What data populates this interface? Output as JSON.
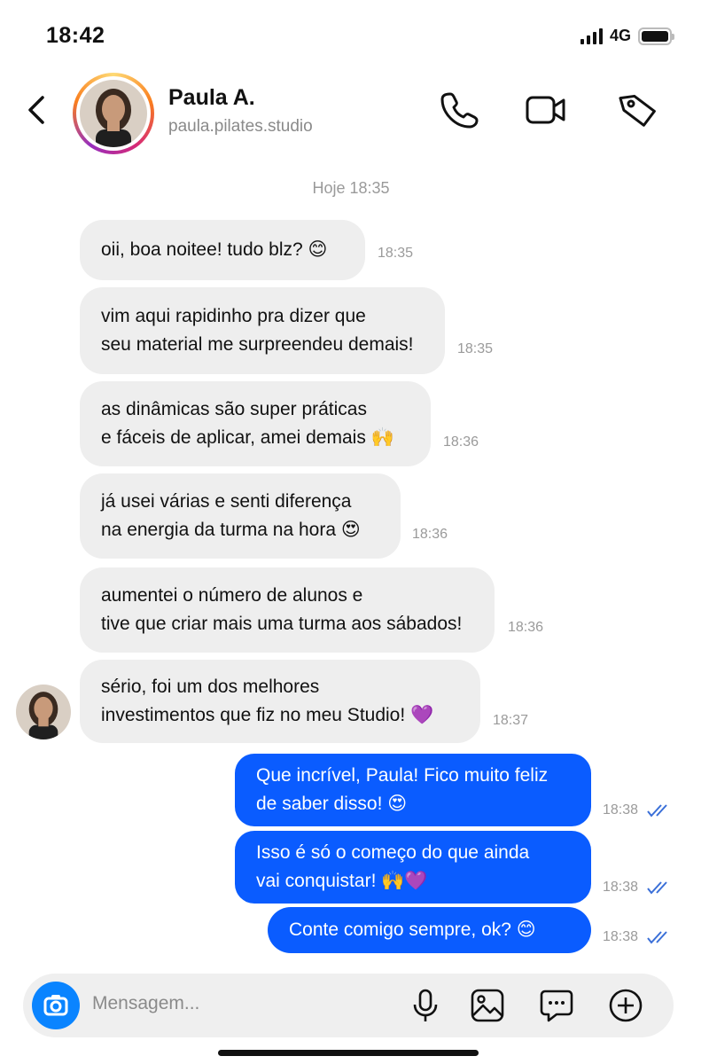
{
  "status_bar": {
    "time": "18:42",
    "network": "4G"
  },
  "header": {
    "contact_name": "Paula A.",
    "contact_handle": "paula.pilates.studio",
    "icons": [
      "back-icon",
      "phone-icon",
      "video-camera-icon",
      "tag-icon"
    ]
  },
  "chat": {
    "day_label": "Hoje 18:35",
    "incoming": [
      {
        "lines": [
          "oii, boa noitee! tudo blz? 😊"
        ],
        "time": "18:35"
      },
      {
        "lines": [
          "vim aqui rapidinho pra dizer que",
          "seu material me surpreendeu demais!"
        ],
        "time": "18:35"
      },
      {
        "lines": [
          "as dinâmicas são super práticas",
          "e fáceis de aplicar, amei demais 🙌"
        ],
        "time": "18:36"
      },
      {
        "lines": [
          "já usei várias e senti diferença",
          "na energia da turma na hora 😍"
        ],
        "time": "18:36"
      },
      {
        "lines": [
          "aumentei o número de alunos e",
          "tive que criar mais uma turma aos sábados!"
        ],
        "time": "18:36"
      },
      {
        "lines": [
          "sério, foi um dos melhores",
          "investimentos que fiz no meu Studio! 💜"
        ],
        "time": "18:37"
      }
    ],
    "outgoing": [
      {
        "lines": [
          "Que incrível, Paula! Fico muito feliz",
          "de saber disso! 😍"
        ],
        "time": "18:38"
      },
      {
        "lines": [
          "Isso é só o começo do que ainda",
          "vai conquistar! 🙌💜"
        ],
        "time": "18:38"
      },
      {
        "lines": [
          "Conte comigo sempre, ok? 😊"
        ],
        "time": "18:38"
      }
    ]
  },
  "composer": {
    "placeholder": "Mensagem...",
    "icons": [
      "camera-icon",
      "microphone-icon",
      "image-icon",
      "sticker-icon",
      "plus-icon"
    ]
  },
  "colors": {
    "outgoing_bubble": "#0a5cff",
    "incoming_bubble": "#eeeeee",
    "camera_button": "#0a84ff",
    "read_ticks": "#3a6fd8"
  }
}
